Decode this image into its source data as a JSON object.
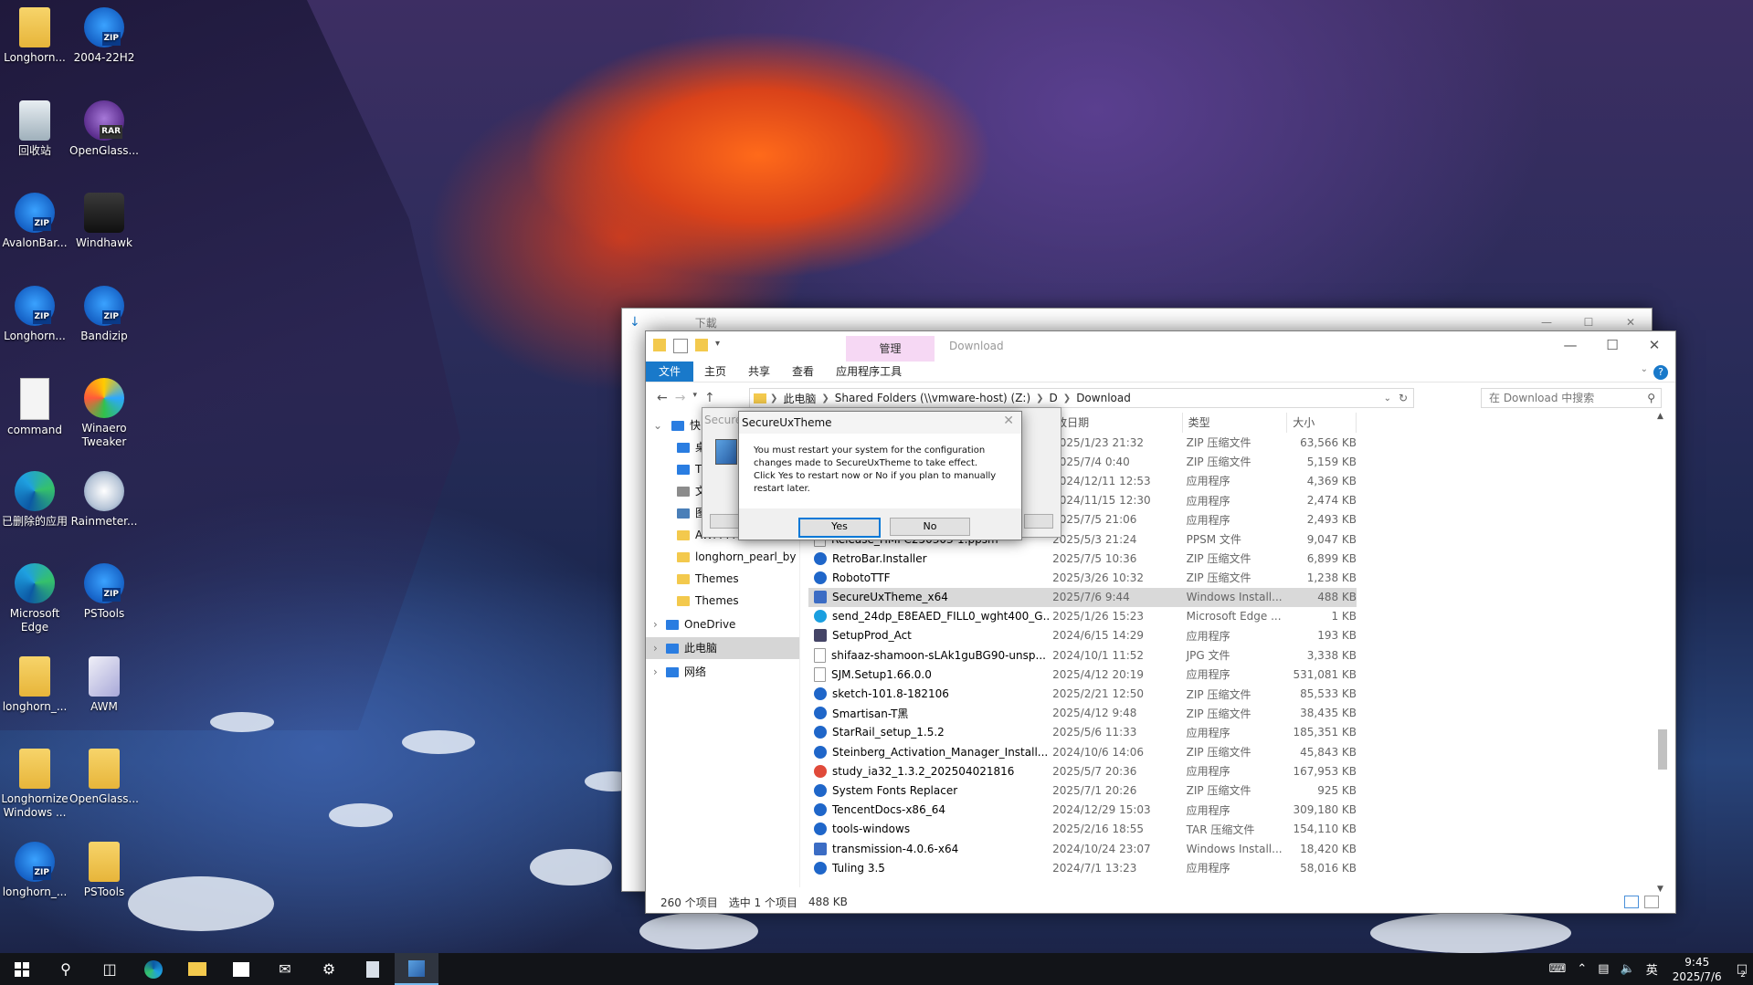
{
  "desktop_icons": [
    {
      "label": "Longhorn...",
      "icon": "folder-doc-icon"
    },
    {
      "label": "2004-22H2",
      "icon": "zip-icon"
    },
    {
      "label": "回收站",
      "icon": "recycle-bin-icon"
    },
    {
      "label": "OpenGlass...",
      "icon": "rar-icon"
    },
    {
      "label": "AvalonBar...",
      "icon": "zip-icon"
    },
    {
      "label": "Windhawk",
      "icon": "windhawk-icon"
    },
    {
      "label": "Longhorn...",
      "icon": "zip-icon"
    },
    {
      "label": "Bandizip",
      "icon": "bandizip-icon"
    },
    {
      "label": "command",
      "icon": "text-file-icon"
    },
    {
      "label": "Winaero Tweaker",
      "icon": "winaero-icon"
    },
    {
      "label": "已删除的应用",
      "icon": "edge-icon"
    },
    {
      "label": "Rainmeter...",
      "icon": "rainmeter-icon"
    },
    {
      "label": "Microsoft Edge",
      "icon": "edge-icon"
    },
    {
      "label": "PSTools",
      "icon": "zip-icon"
    },
    {
      "label": "longhorn_...",
      "icon": "folder-doc-icon"
    },
    {
      "label": "AWM",
      "icon": "awm-icon"
    },
    {
      "label": "Longhornize Windows ...",
      "icon": "folder-doc-icon"
    },
    {
      "label": "OpenGlass...",
      "icon": "folder-doc-icon"
    },
    {
      "label": "longhorn_...",
      "icon": "zip-icon"
    },
    {
      "label": "PSTools",
      "icon": "folder-doc-icon"
    }
  ],
  "back_window": {
    "title": "下載"
  },
  "explorer": {
    "context_tab": "管理",
    "title": "Download",
    "ribbon_tabs": [
      "文件",
      "主页",
      "共享",
      "查看",
      "应用程序工具"
    ],
    "breadcrumbs": [
      "此电脑",
      "Shared Folders (\\\\vmware-host) (Z:)",
      "D",
      "Download"
    ],
    "search_placeholder": "在 Download 中搜索",
    "nav": {
      "items": [
        {
          "label": "快",
          "kind": "quick"
        },
        {
          "label": "桌",
          "kind": "desktop"
        },
        {
          "label": "T",
          "kind": "download"
        },
        {
          "label": "文",
          "kind": "doc"
        },
        {
          "label": "图",
          "kind": "pic"
        },
        {
          "label": "AWM Presets",
          "kind": "folder"
        },
        {
          "label": "longhorn_pearl_by",
          "kind": "folder"
        },
        {
          "label": "Themes",
          "kind": "folder"
        },
        {
          "label": "Themes",
          "kind": "folder"
        },
        {
          "label": "OneDrive",
          "kind": "cloud"
        },
        {
          "label": "此电脑",
          "kind": "pc"
        },
        {
          "label": "网络",
          "kind": "net"
        }
      ]
    },
    "columns": {
      "date": "改日期",
      "type": "类型",
      "size": "大小"
    },
    "rows": [
      {
        "name": "",
        "date": "2025/1/23 21:32",
        "type": "ZIP 压缩文件",
        "size": "63,566 KB",
        "icon": "zip"
      },
      {
        "name": "",
        "date": "2025/7/4 0:40",
        "type": "ZIP 压缩文件",
        "size": "5,159 KB",
        "icon": "zip"
      },
      {
        "name": "",
        "date": "2024/12/11 12:53",
        "type": "应用程序",
        "size": "4,369 KB",
        "icon": "app"
      },
      {
        "name": "",
        "date": "2024/11/15 12:30",
        "type": "应用程序",
        "size": "2,474 KB",
        "icon": "app"
      },
      {
        "name": "",
        "date": "2025/7/5 21:06",
        "type": "应用程序",
        "size": "2,493 KB",
        "icon": "app"
      },
      {
        "name": "Release_HMPC250303-1.ppsm",
        "date": "2025/5/3 21:24",
        "type": "PPSM 文件",
        "size": "9,047 KB",
        "icon": "doc"
      },
      {
        "name": "RetroBar.Installer",
        "date": "2025/7/5 10:36",
        "type": "ZIP 压缩文件",
        "size": "6,899 KB",
        "icon": "zip"
      },
      {
        "name": "RobotoTTF",
        "date": "2025/3/26 10:32",
        "type": "ZIP 压缩文件",
        "size": "1,238 KB",
        "icon": "zip"
      },
      {
        "name": "SecureUxTheme_x64",
        "date": "2025/7/6 9:44",
        "type": "Windows Install...",
        "size": "488 KB",
        "icon": "msi",
        "selected": true
      },
      {
        "name": "send_24dp_E8EAED_FILL0_wght400_G...",
        "date": "2025/1/26 15:23",
        "type": "Microsoft Edge ...",
        "size": "1 KB",
        "icon": "edge"
      },
      {
        "name": "SetupProd_Act",
        "date": "2024/6/15 14:29",
        "type": "应用程序",
        "size": "193 KB",
        "icon": "gear"
      },
      {
        "name": "shifaaz-shamoon-sLAk1guBG90-unsp...",
        "date": "2024/10/1 11:52",
        "type": "JPG 文件",
        "size": "3,338 KB",
        "icon": "doc"
      },
      {
        "name": "SJM.Setup1.66.0.0",
        "date": "2025/4/12 20:19",
        "type": "应用程序",
        "size": "531,081 KB",
        "icon": "doc"
      },
      {
        "name": "sketch-101.8-182106",
        "date": "2025/2/21 12:50",
        "type": "ZIP 压缩文件",
        "size": "85,533 KB",
        "icon": "zip"
      },
      {
        "name": "Smartisan-T黑",
        "date": "2025/4/12 9:48",
        "type": "ZIP 压缩文件",
        "size": "38,435 KB",
        "icon": "zip"
      },
      {
        "name": "StarRail_setup_1.5.2",
        "date": "2025/5/6 11:33",
        "type": "应用程序",
        "size": "185,351 KB",
        "icon": "zip"
      },
      {
        "name": "Steinberg_Activation_Manager_Install...",
        "date": "2024/10/6 14:06",
        "type": "ZIP 压缩文件",
        "size": "45,843 KB",
        "icon": "zip"
      },
      {
        "name": "study_ia32_1.3.2_202504021816",
        "date": "2025/5/7 20:36",
        "type": "应用程序",
        "size": "167,953 KB",
        "icon": "red"
      },
      {
        "name": "System Fonts Replacer",
        "date": "2025/7/1 20:26",
        "type": "ZIP 压缩文件",
        "size": "925 KB",
        "icon": "zip"
      },
      {
        "name": "TencentDocs-x86_64",
        "date": "2024/12/29 15:03",
        "type": "应用程序",
        "size": "309,180 KB",
        "icon": "zip"
      },
      {
        "name": "tools-windows",
        "date": "2025/2/16 18:55",
        "type": "TAR 压缩文件",
        "size": "154,110 KB",
        "icon": "zip"
      },
      {
        "name": "transmission-4.0.6-x64",
        "date": "2024/10/24 23:07",
        "type": "Windows Install...",
        "size": "18,420 KB",
        "icon": "msi"
      },
      {
        "name": "Tuling 3.5",
        "date": "2024/7/1 13:23",
        "type": "应用程序",
        "size": "58,016 KB",
        "icon": "zip"
      }
    ],
    "status": {
      "count": "260 个项目",
      "selected": "选中 1 个项目",
      "size": "488 KB"
    }
  },
  "dialog_back": {
    "title": "Secure"
  },
  "dialog": {
    "title": "SecureUxTheme",
    "message_line1": "You must restart your system for the configuration",
    "message_line2": "changes made to SecureUxTheme to take effect.",
    "message_line3": "Click Yes to restart now or No if you plan to manually",
    "message_line4": "restart later.",
    "yes": "Yes",
    "no": "No"
  },
  "taskbar": {
    "time": "9:45",
    "date": "2025/7/6",
    "ime": "英",
    "notification_count": "2"
  }
}
